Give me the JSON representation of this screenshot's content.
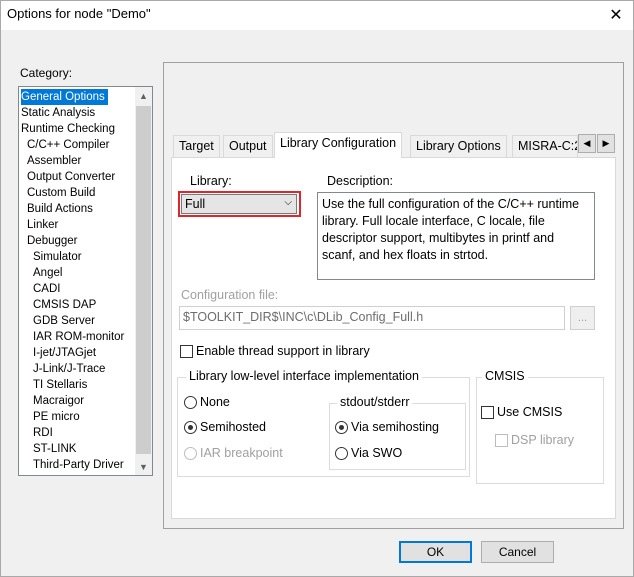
{
  "window": {
    "title": "Options for node \"Demo\"",
    "close_glyph": "✕"
  },
  "category": {
    "label": "Category:",
    "items": [
      {
        "label": "General Options",
        "indent": 0
      },
      {
        "label": "Static Analysis",
        "indent": 0
      },
      {
        "label": "Runtime Checking",
        "indent": 0
      },
      {
        "label": "C/C++ Compiler",
        "indent": 1
      },
      {
        "label": "Assembler",
        "indent": 1
      },
      {
        "label": "Output Converter",
        "indent": 1
      },
      {
        "label": "Custom Build",
        "indent": 1
      },
      {
        "label": "Build Actions",
        "indent": 1
      },
      {
        "label": "Linker",
        "indent": 1
      },
      {
        "label": "Debugger",
        "indent": 1
      },
      {
        "label": "Simulator",
        "indent": 2
      },
      {
        "label": "Angel",
        "indent": 2
      },
      {
        "label": "CADI",
        "indent": 2
      },
      {
        "label": "CMSIS DAP",
        "indent": 2
      },
      {
        "label": "GDB Server",
        "indent": 2
      },
      {
        "label": "IAR ROM-monitor",
        "indent": 2
      },
      {
        "label": "I-jet/JTAGjet",
        "indent": 2
      },
      {
        "label": "J-Link/J-Trace",
        "indent": 2
      },
      {
        "label": "TI Stellaris",
        "indent": 2
      },
      {
        "label": "Macraigor",
        "indent": 2
      },
      {
        "label": "PE micro",
        "indent": 2
      },
      {
        "label": "RDI",
        "indent": 2
      },
      {
        "label": "ST-LINK",
        "indent": 2
      },
      {
        "label": "Third-Party Driver",
        "indent": 2
      }
    ],
    "selected": "General Options"
  },
  "tabs": [
    {
      "label": "Target"
    },
    {
      "label": "Output"
    },
    {
      "label": "Library Configuration"
    },
    {
      "label": "Library Options"
    },
    {
      "label": "MISRA-C:2"
    }
  ],
  "active_tab": "Library Configuration",
  "library": {
    "label": "Library:",
    "value": "Full"
  },
  "description": {
    "label": "Description:",
    "text": "Use the full configuration of the C/C++ runtime library. Full locale interface, C locale, file descriptor support, multibytes in printf and scanf, and hex floats in strtod."
  },
  "config_file": {
    "label": "Configuration file:",
    "value": "$TOOLKIT_DIR$\\INC\\c\\DLib_Config_Full.h",
    "browse_label": "..."
  },
  "thread_support": {
    "label": "Enable thread support in library",
    "checked": false
  },
  "lowlevel": {
    "title": "Library low-level interface implementation",
    "options": [
      {
        "label": "None",
        "checked": false,
        "disabled": false
      },
      {
        "label": "Semihosted",
        "checked": true,
        "disabled": false
      },
      {
        "label": "IAR breakpoint",
        "checked": false,
        "disabled": true
      }
    ]
  },
  "stdout": {
    "title": "stdout/stderr",
    "options": [
      {
        "label": "Via semihosting",
        "checked": true
      },
      {
        "label": "Via SWO",
        "checked": false
      }
    ]
  },
  "cmsis": {
    "title": "CMSIS",
    "use_label": "Use CMSIS",
    "dsp_label": "DSP library"
  },
  "buttons": {
    "ok": "OK",
    "cancel": "Cancel"
  }
}
